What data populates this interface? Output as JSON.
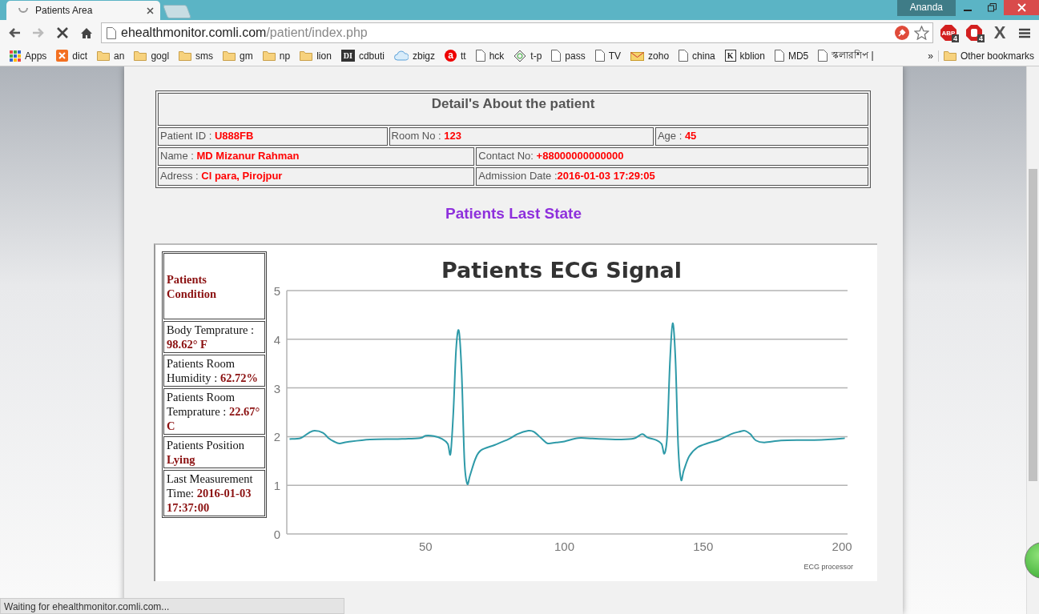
{
  "browser": {
    "tabs": [
      {
        "title": "Patients Area",
        "selected": true,
        "loading": true
      }
    ],
    "profile": "Ananda",
    "nav": {
      "back_disabled": false,
      "forward_disabled": true,
      "loading": true
    },
    "address": {
      "host": "ehealthmonitor.comli.com",
      "path": "/patient/index.php"
    },
    "extensions": [
      {
        "kind": "abp",
        "glyph": "ABP",
        "count": "4"
      },
      {
        "kind": "hand",
        "count": "4"
      },
      {
        "kind": "x",
        "glyph": "X"
      }
    ],
    "bookmarks": [
      {
        "label": "Apps",
        "kind": "apps"
      },
      {
        "label": "dict",
        "kind": "xampp"
      },
      {
        "label": "an",
        "kind": "folder"
      },
      {
        "label": "gogl",
        "kind": "folder"
      },
      {
        "label": "sms",
        "kind": "folder"
      },
      {
        "label": "gm",
        "kind": "folder"
      },
      {
        "label": "np",
        "kind": "folder"
      },
      {
        "label": "lion",
        "kind": "folder"
      },
      {
        "label": "cdbuti",
        "kind": "letter",
        "glyph": "DI"
      },
      {
        "label": "zbigz",
        "kind": "cloud"
      },
      {
        "label": "tt",
        "kind": "circle",
        "glyph": "a"
      },
      {
        "label": "hck",
        "kind": "page"
      },
      {
        "label": "t-p",
        "kind": "diamond"
      },
      {
        "label": "pass",
        "kind": "page"
      },
      {
        "label": "TV",
        "kind": "page"
      },
      {
        "label": "zoho",
        "kind": "mail"
      },
      {
        "label": "china",
        "kind": "page"
      },
      {
        "label": "kblion",
        "kind": "letter",
        "glyph": "K"
      },
      {
        "label": "MD5",
        "kind": "page"
      },
      {
        "label": "স্কলারশিপ |",
        "kind": "page"
      }
    ],
    "more": "»",
    "other_bookmarks": "Other bookmarks",
    "status": "Waiting for ehealthmonitor.comli.com..."
  },
  "details": {
    "title": "Detail's About the patient",
    "rows": [
      [
        {
          "label": "Patient ID : ",
          "value": "U888FB"
        },
        {
          "label": "Room No : ",
          "value": "123"
        },
        {
          "label": "Age : ",
          "value": "45"
        }
      ],
      [
        {
          "label": "Name : ",
          "value": "MD Mizanur Rahman"
        },
        {
          "label": "Contact No: ",
          "value": "+88000000000000"
        }
      ],
      [
        {
          "label": "Adress : ",
          "value": "Cl para, Pirojpur"
        },
        {
          "label": "Admission Date :",
          "value": "2016-01-03 17:29:05"
        }
      ]
    ]
  },
  "section_title": "Patients Last State",
  "condition": {
    "title": "Patients Condition",
    "items": [
      {
        "label": "Body Temprature : ",
        "value": "98.62° F"
      },
      {
        "label": "Patients Room Humidity : ",
        "value": "62.72%"
      },
      {
        "label": "Patients Room Temprature : ",
        "value": "22.67° C"
      },
      {
        "label": "Patients Position ",
        "value": "Lying"
      },
      {
        "label": "Last Measurement Time: ",
        "value": "2016-01-03 17:37:00"
      }
    ]
  },
  "ecg": {
    "credit": "ECG processor",
    "chart_data": {
      "type": "line",
      "title": "Patients ECG Signal",
      "x": [
        1,
        5,
        8,
        10,
        13,
        15,
        17,
        19,
        22,
        30,
        40,
        48,
        50,
        53,
        56,
        58,
        59,
        60,
        61,
        62,
        63,
        64,
        65,
        66,
        68,
        70,
        75,
        80,
        83,
        87,
        89,
        92,
        94,
        97,
        100,
        105,
        110,
        115,
        120,
        125,
        128,
        130,
        133,
        135,
        136,
        137,
        138,
        139,
        140,
        141,
        142,
        143,
        145,
        148,
        152,
        156,
        160,
        163,
        165,
        167,
        169,
        172,
        178,
        185,
        190,
        195,
        200,
        201
      ],
      "series": [
        {
          "color": "#2e9aa8",
          "values": [
            1.95,
            1.97,
            2.08,
            2.12,
            2.08,
            1.97,
            1.9,
            1.86,
            1.89,
            1.94,
            1.95,
            1.97,
            2.02,
            2.01,
            1.95,
            1.85,
            1.65,
            2.5,
            3.8,
            4.17,
            3.3,
            1.5,
            1.03,
            1.2,
            1.55,
            1.72,
            1.83,
            1.95,
            2.05,
            2.12,
            2.1,
            1.95,
            1.86,
            1.88,
            1.9,
            1.97,
            1.96,
            1.95,
            1.94,
            1.96,
            2.05,
            1.98,
            1.93,
            1.85,
            1.65,
            2.0,
            3.5,
            4.33,
            3.6,
            1.8,
            1.12,
            1.3,
            1.6,
            1.78,
            1.87,
            1.94,
            2.05,
            2.1,
            2.12,
            2.05,
            1.92,
            1.88,
            1.92,
            1.93,
            1.93,
            1.94,
            1.96,
            1.97
          ]
        }
      ],
      "grid": true,
      "xlim": [
        0,
        202
      ],
      "ylim": [
        0,
        5
      ],
      "xticks": [
        50,
        100,
        150,
        200
      ],
      "yticks": [
        0,
        1,
        2,
        3,
        4,
        5
      ]
    }
  }
}
